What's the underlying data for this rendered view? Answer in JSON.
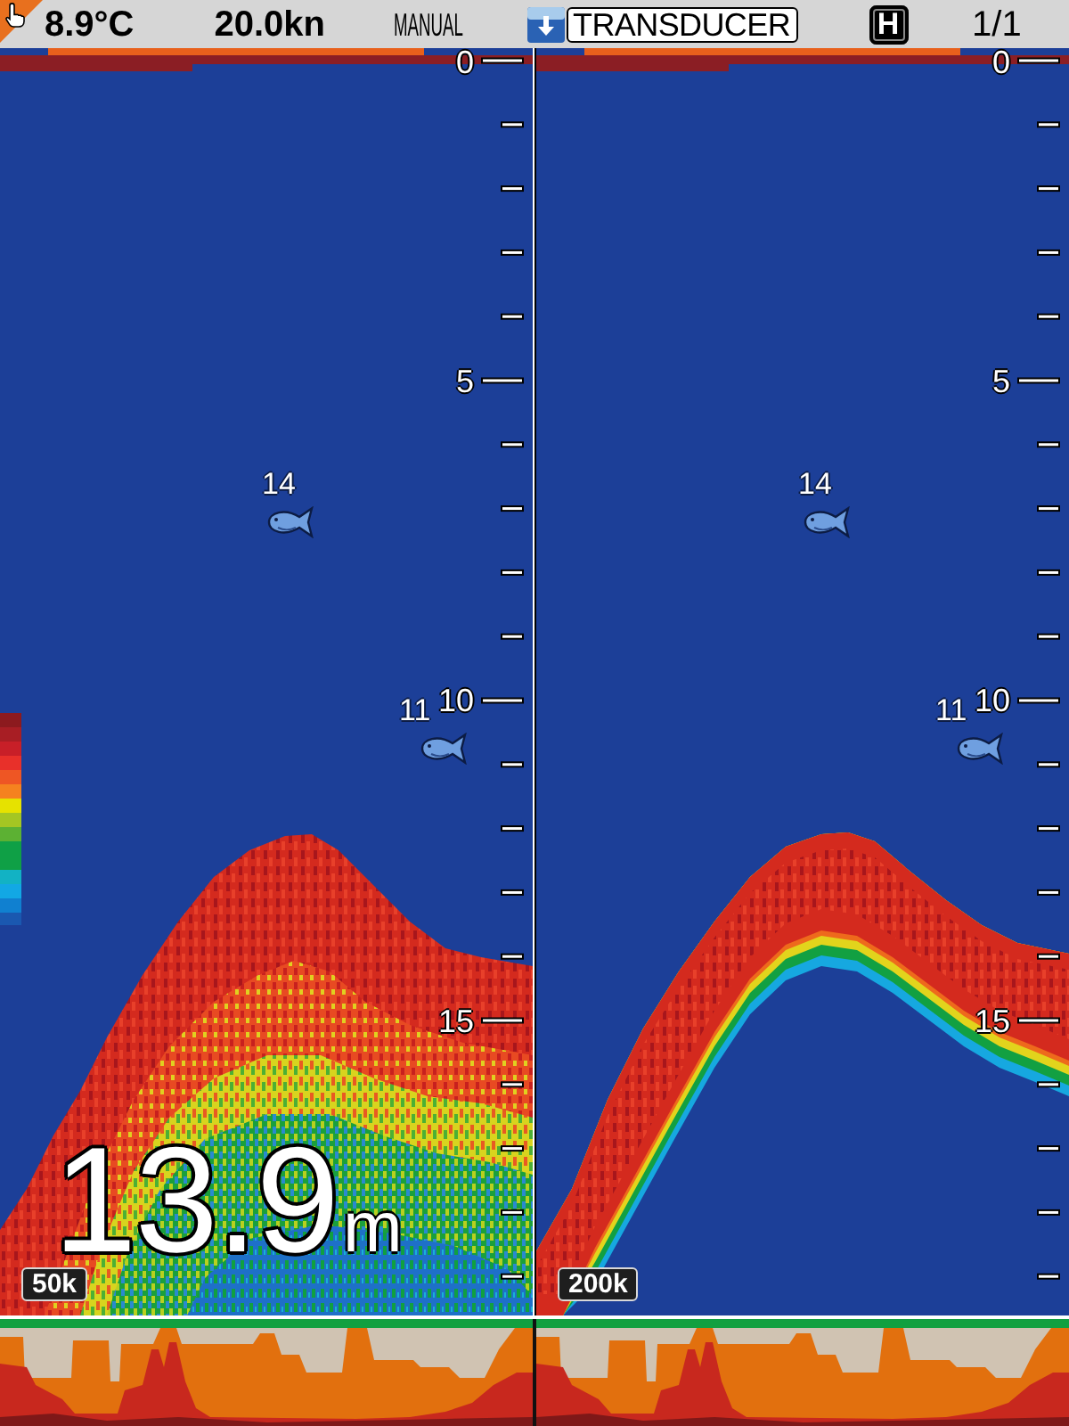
{
  "status_bar": {
    "water_temperature": "8.9°C",
    "speed": "20.0kn",
    "gain_mode": "MANUAL",
    "source": "TRANSDUCER",
    "mode_badge": "H",
    "page": "1/1"
  },
  "panels": [
    {
      "depth_scale": [
        "0",
        "5",
        "10",
        "15"
      ],
      "fish": [
        {
          "label": "14"
        },
        {
          "label": "11"
        }
      ],
      "frequency": "50k",
      "depth_reading": {
        "value": "13.9",
        "unit": "m"
      }
    },
    {
      "depth_scale": [
        "0",
        "5",
        "10",
        "15"
      ],
      "fish": [
        {
          "label": "14"
        },
        {
          "label": "11"
        }
      ],
      "frequency": "200k"
    }
  ]
}
